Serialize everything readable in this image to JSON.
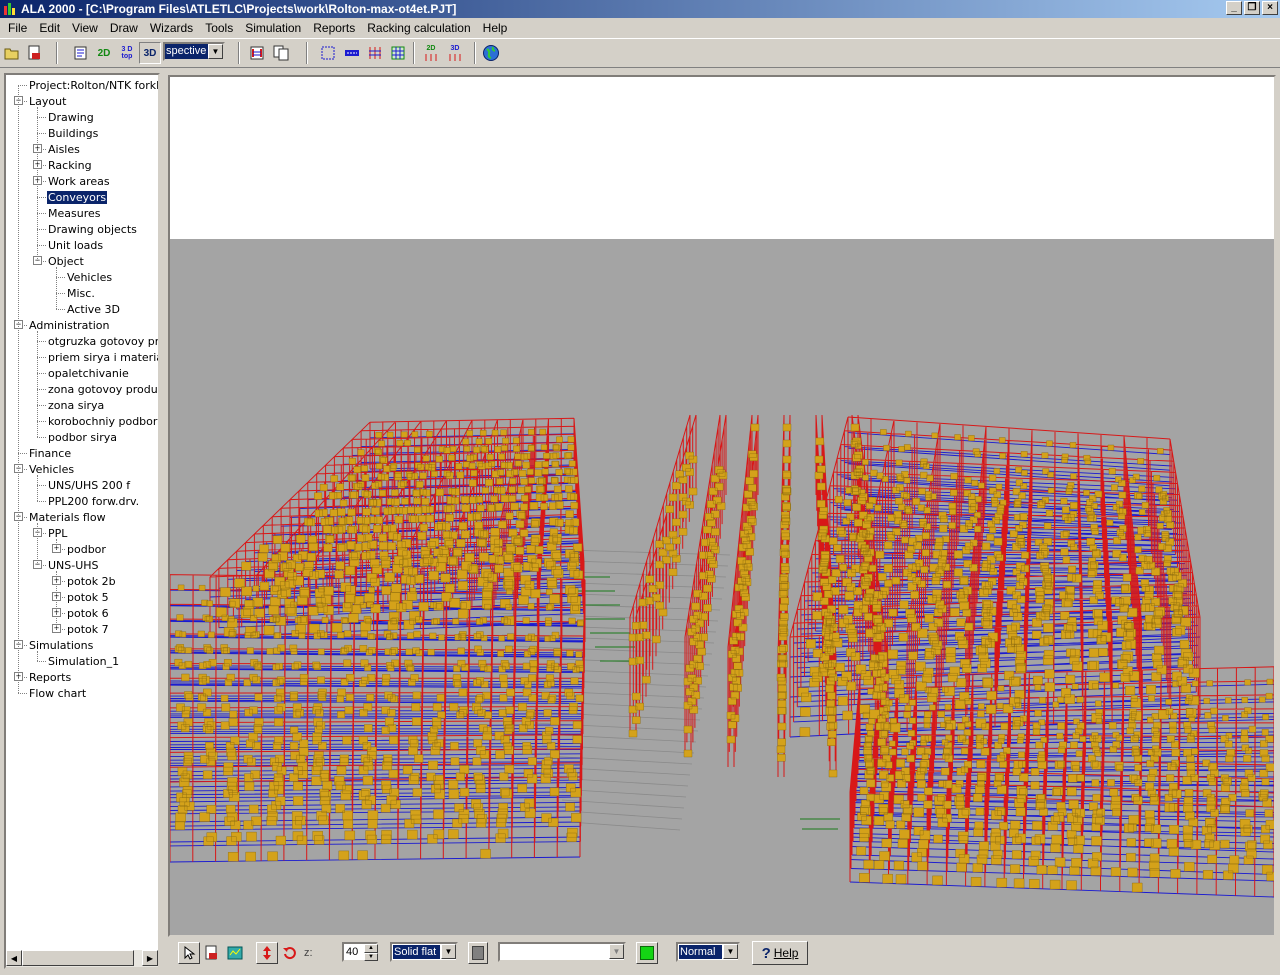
{
  "window": {
    "title": "ALA 2000 - [C:\\Program Files\\ATLETLC\\Projects\\work\\Rolton-max-ot4et.PJT]"
  },
  "menu": [
    "File",
    "Edit",
    "View",
    "Draw",
    "Wizards",
    "Tools",
    "Simulation",
    "Reports",
    "Racking calculation",
    "Help"
  ],
  "toolbar": {
    "btn_2d": "2D",
    "btn_3dtop_1": "3 D",
    "btn_3dtop_2": "top",
    "btn_3d": "3D",
    "view_mode_value": "spective",
    "btn_calc2d": "2D",
    "btn_calc3d": "3D"
  },
  "tree": [
    {
      "label": "Project:Rolton/NTK forklift",
      "level": 0,
      "exp": ""
    },
    {
      "label": "Layout",
      "level": 0,
      "exp": "-"
    },
    {
      "label": "Drawing",
      "level": 1,
      "exp": ""
    },
    {
      "label": "Buildings",
      "level": 1,
      "exp": ""
    },
    {
      "label": "Aisles",
      "level": 1,
      "exp": "+"
    },
    {
      "label": "Racking",
      "level": 1,
      "exp": "+"
    },
    {
      "label": "Work areas",
      "level": 1,
      "exp": "+"
    },
    {
      "label": "Conveyors",
      "level": 1,
      "exp": "",
      "selected": true
    },
    {
      "label": "Measures",
      "level": 1,
      "exp": ""
    },
    {
      "label": "Drawing objects",
      "level": 1,
      "exp": ""
    },
    {
      "label": "Unit loads",
      "level": 1,
      "exp": ""
    },
    {
      "label": "Object",
      "level": 1,
      "exp": "-"
    },
    {
      "label": "Vehicles",
      "level": 2,
      "exp": ""
    },
    {
      "label": "Misc.",
      "level": 2,
      "exp": ""
    },
    {
      "label": "Active 3D",
      "level": 2,
      "exp": ""
    },
    {
      "label": "Administration",
      "level": 0,
      "exp": "-"
    },
    {
      "label": "otgruzka gotovoy produ",
      "level": 1,
      "exp": ""
    },
    {
      "label": "priem sirya i materialov",
      "level": 1,
      "exp": ""
    },
    {
      "label": "opaletchivanie",
      "level": 1,
      "exp": ""
    },
    {
      "label": "zona gotovoy produkcii",
      "level": 1,
      "exp": ""
    },
    {
      "label": "zona sirya",
      "level": 1,
      "exp": ""
    },
    {
      "label": "korobochniy podbor",
      "level": 1,
      "exp": ""
    },
    {
      "label": "podbor sirya",
      "level": 1,
      "exp": ""
    },
    {
      "label": "Finance",
      "level": 0,
      "exp": ""
    },
    {
      "label": "Vehicles",
      "level": 0,
      "exp": "-"
    },
    {
      "label": "UNS/UHS 200 f",
      "level": 1,
      "exp": ""
    },
    {
      "label": "PPL200 forw.drv.",
      "level": 1,
      "exp": ""
    },
    {
      "label": "Materials flow",
      "level": 0,
      "exp": "-"
    },
    {
      "label": "PPL",
      "level": 1,
      "exp": "-"
    },
    {
      "label": "podbor",
      "level": 2,
      "exp": "+"
    },
    {
      "label": "UNS-UHS",
      "level": 1,
      "exp": "-"
    },
    {
      "label": "potok 2b",
      "level": 2,
      "exp": "+"
    },
    {
      "label": "potok 5",
      "level": 2,
      "exp": "+"
    },
    {
      "label": "potok 6",
      "level": 2,
      "exp": "+"
    },
    {
      "label": "potok 7",
      "level": 2,
      "exp": "+"
    },
    {
      "label": "Simulations",
      "level": 0,
      "exp": "-"
    },
    {
      "label": "Simulation_1",
      "level": 1,
      "exp": ""
    },
    {
      "label": "Reports",
      "level": 0,
      "exp": "+"
    },
    {
      "label": "Flow chart",
      "level": 0,
      "exp": ""
    }
  ],
  "bottom": {
    "z_label": "z:",
    "z_value": "40",
    "render_mode": "Solid flat",
    "layer_value": "",
    "speed_value": "Normal",
    "help_label": "Help"
  },
  "colors": {
    "rack_upright": "#d81818",
    "rack_beam": "#1a1ad0",
    "pallet": "#d4a21a",
    "floor": "#a4a4a4",
    "sky": "#ffffff",
    "aisle_marker": "#1a7a1a",
    "titlebar_start": "#0a246a",
    "selection": "#0a246a"
  }
}
